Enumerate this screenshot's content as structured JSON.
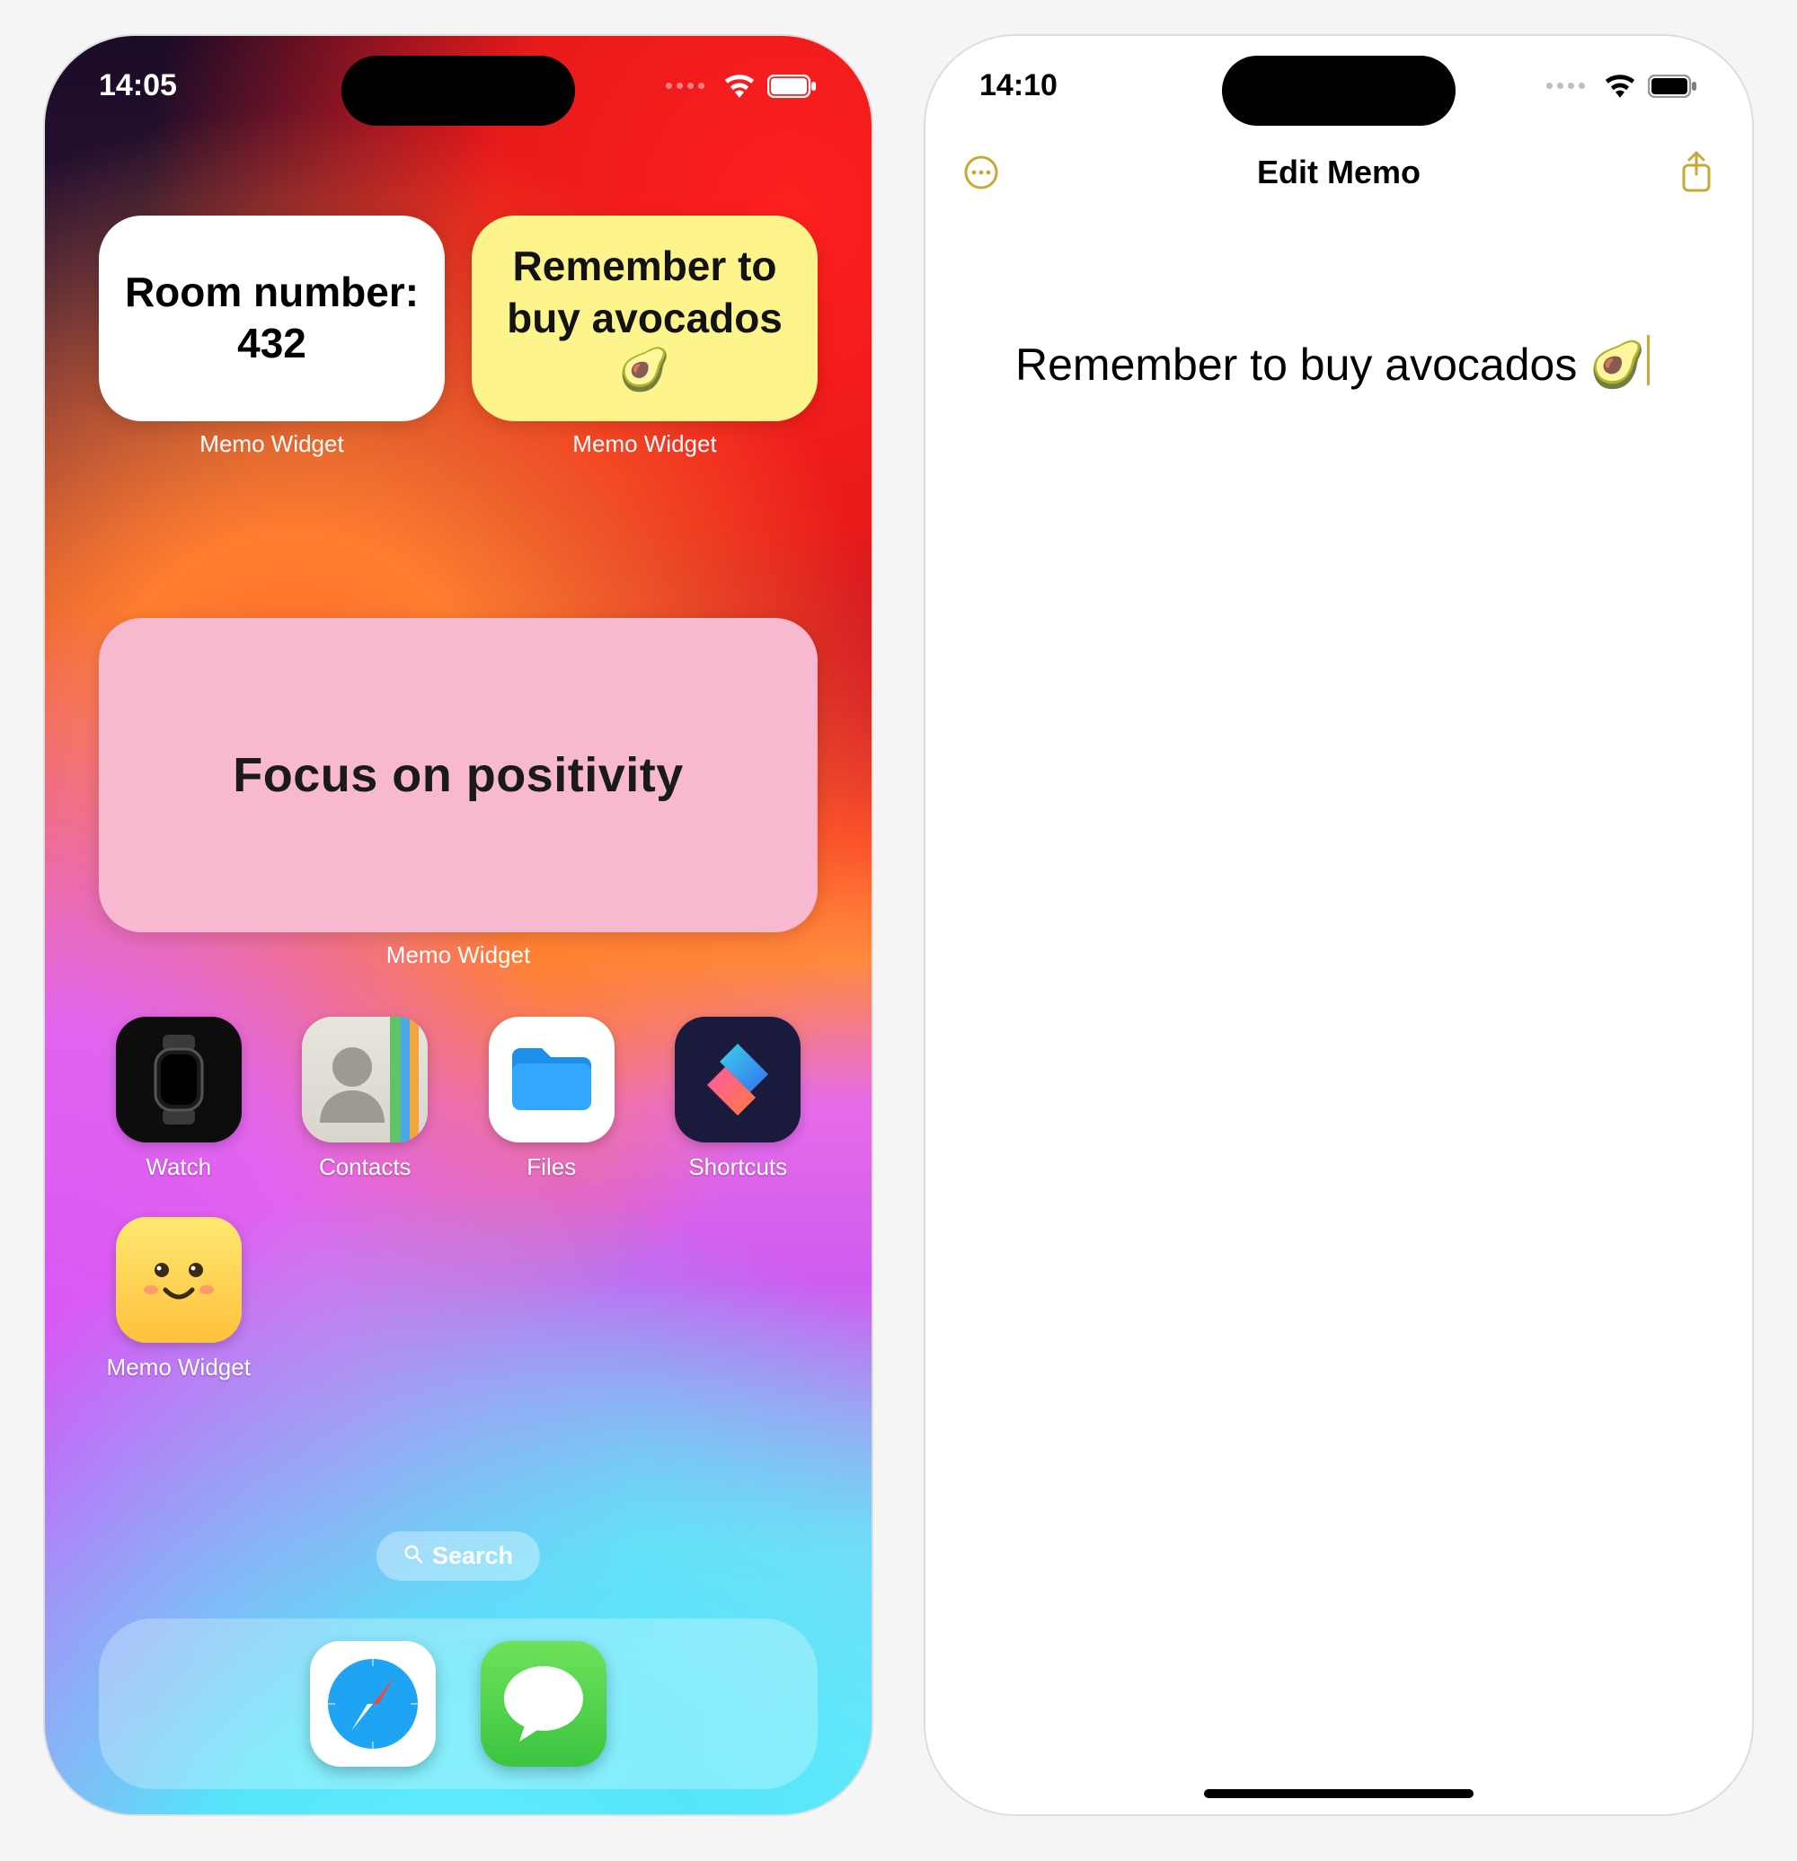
{
  "left": {
    "status": {
      "time": "14:05"
    },
    "widgets": {
      "small1": {
        "text": "Room number: 432",
        "label": "Memo Widget"
      },
      "small2": {
        "text": "Remember to buy avocados 🥑",
        "label": "Memo Widget"
      },
      "wide": {
        "text": "Focus on positivity",
        "label": "Memo Widget"
      }
    },
    "apps": {
      "watch": "Watch",
      "contacts": "Contacts",
      "files": "Files",
      "shortcuts": "Shortcuts",
      "memo": "Memo Widget"
    },
    "search": "Search",
    "dock": {
      "safari": "Safari",
      "messages": "Messages"
    }
  },
  "right": {
    "status": {
      "time": "14:10"
    },
    "nav": {
      "title": "Edit Memo"
    },
    "memo_text": "Remember to buy avocados 🥑"
  }
}
